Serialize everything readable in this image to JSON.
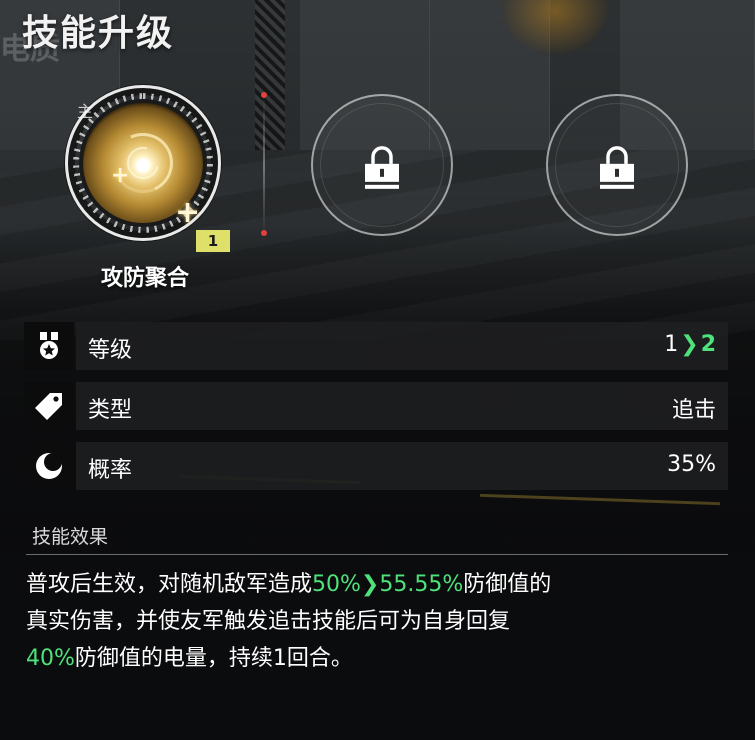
{
  "header": {
    "title": "技能升级",
    "ghost_text": "电质"
  },
  "skill_slots": {
    "active": {
      "main_tag": "主",
      "name": "攻防聚合",
      "level_badge": "1",
      "icon": "shield-burst-icon"
    },
    "locked": [
      {
        "icon": "lock-icon"
      },
      {
        "icon": "lock-icon"
      }
    ]
  },
  "stats": {
    "level": {
      "icon": "medal-icon",
      "label": "等级",
      "from": "1",
      "arrow": "❯",
      "to": "2"
    },
    "type": {
      "icon": "tag-icon",
      "label": "类型",
      "value": "追击"
    },
    "rate": {
      "icon": "moon-icon",
      "label": "概率",
      "value": "35%"
    }
  },
  "effect": {
    "header": "技能效果",
    "line1_pre": "普攻后生效，对随机敌军造成",
    "line1_v1": "50%",
    "line1_arrow": "❯",
    "line1_v2": "55.55%",
    "line1_post": "防御值的",
    "line2": "真实伤害，并使友军触发追击技能后可为自身回复",
    "line3_v": "40%",
    "line3_post": "防御值的电量，持续1回合。"
  },
  "colors": {
    "highlight_green": "#4fe27a",
    "badge_yellow": "#dfe06a"
  }
}
